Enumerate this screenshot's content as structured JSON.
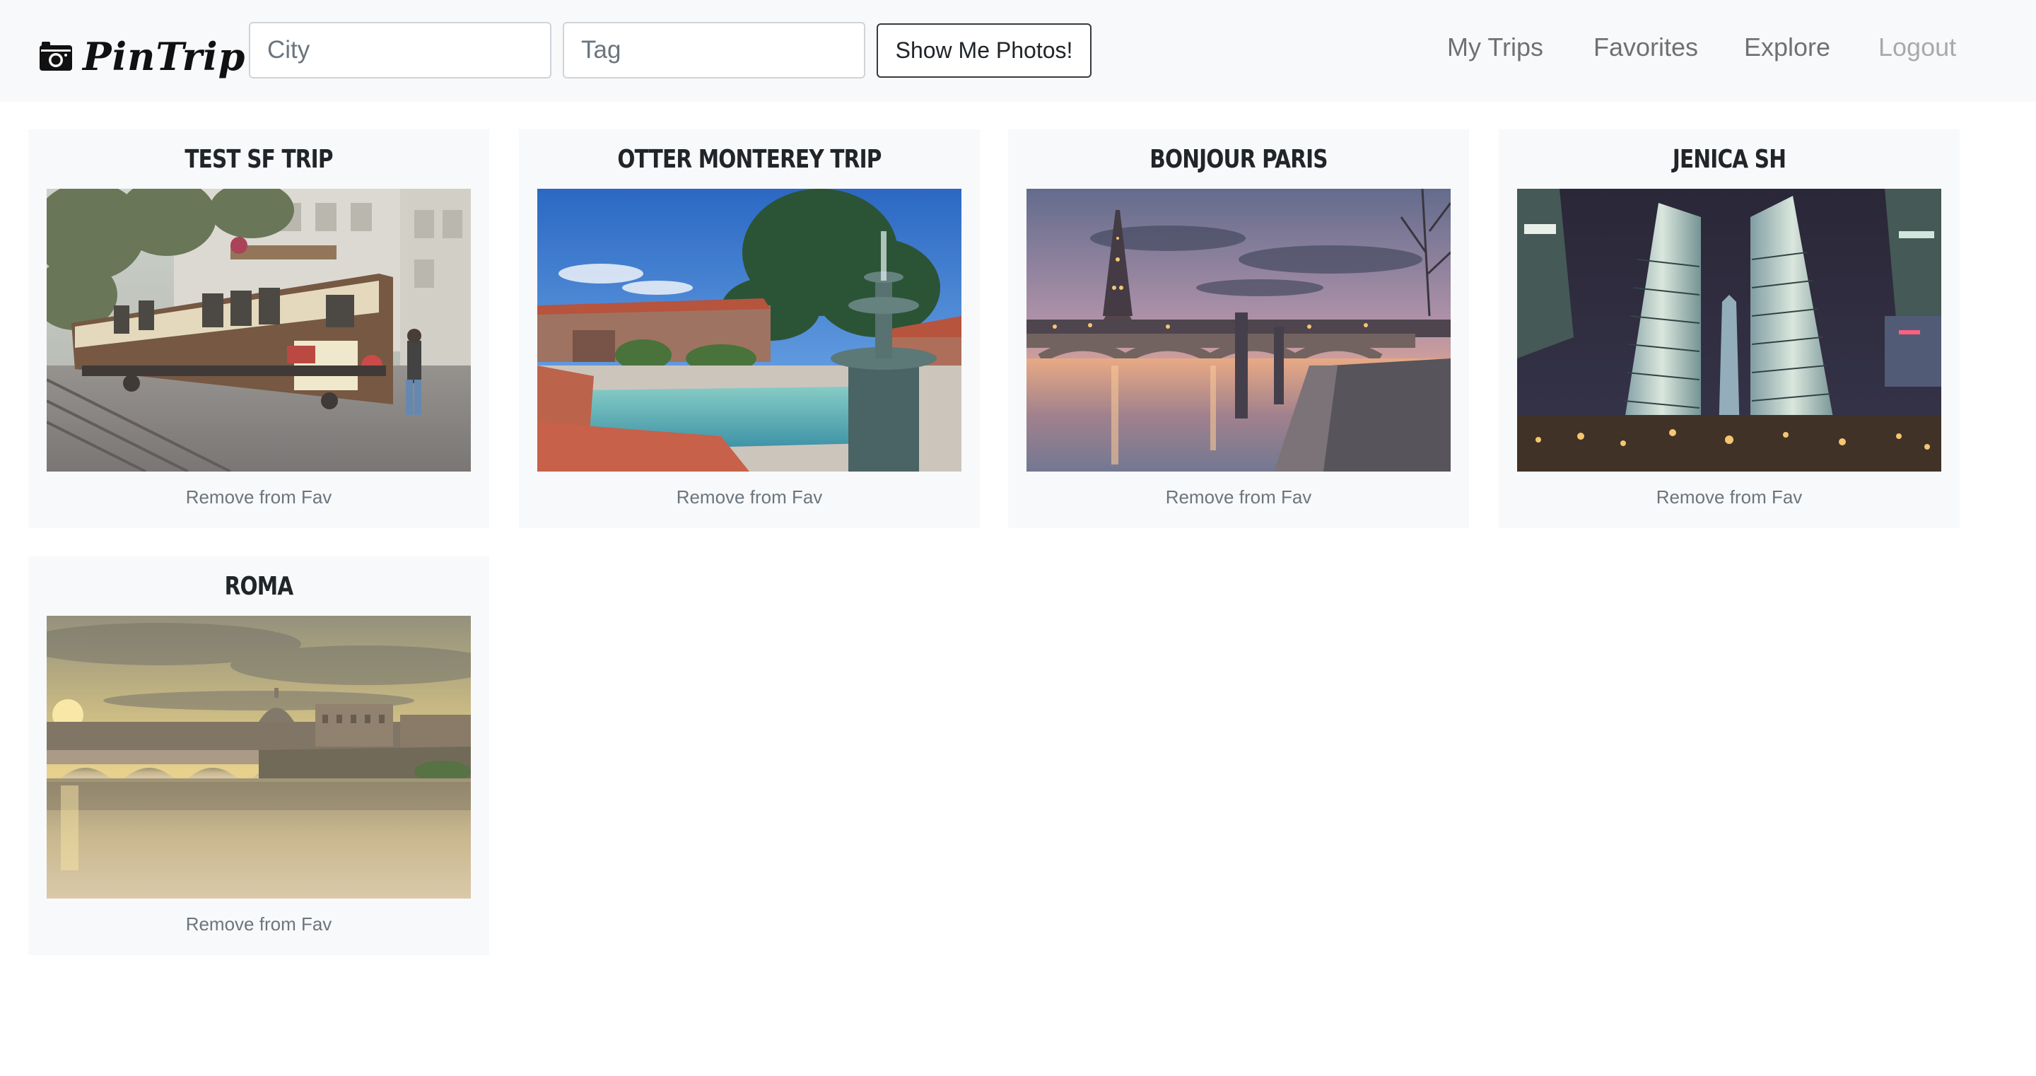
{
  "navbar": {
    "brand": "PinTrip",
    "brand_icon": "camera-icon",
    "city_placeholder": "City",
    "city_value": "",
    "tag_placeholder": "Tag",
    "tag_value": "",
    "submit_label": "Show Me Photos!",
    "links": {
      "my_trips": "My Trips",
      "favorites": "Favorites",
      "explore": "Explore",
      "logout": "Logout"
    }
  },
  "cards": [
    {
      "title": "TEST SF TRIP",
      "action": "Remove from Fav",
      "photo": "san-francisco-cable-car-photo"
    },
    {
      "title": "OTTER MONTEREY TRIP",
      "action": "Remove from Fav",
      "photo": "monterey-fountain-photo"
    },
    {
      "title": "BONJOUR PARIS",
      "action": "Remove from Fav",
      "photo": "paris-seine-sunset-photo"
    },
    {
      "title": "JENICA SH",
      "action": "Remove from Fav",
      "photo": "shanghai-skyscrapers-photo"
    },
    {
      "title": "ROMA",
      "action": "Remove from Fav",
      "photo": "rome-tiber-sunset-photo"
    }
  ]
}
